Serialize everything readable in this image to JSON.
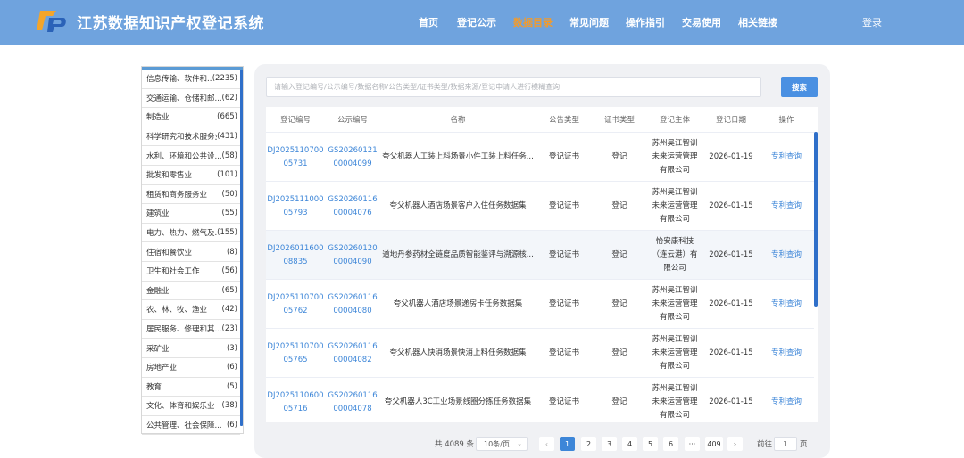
{
  "header": {
    "title": "江苏数据知识产权登记系统",
    "nav": [
      {
        "label": "首页",
        "active": false
      },
      {
        "label": "登记公示",
        "active": false
      },
      {
        "label": "数据目录",
        "active": true
      },
      {
        "label": "常见问题",
        "active": false
      },
      {
        "label": "操作指引",
        "active": false
      },
      {
        "label": "交易使用",
        "active": false
      },
      {
        "label": "相关链接",
        "active": false
      }
    ],
    "login": "登录",
    "accent_color": "#f39b2b",
    "bg_color": "#6fa3de"
  },
  "sidebar": {
    "categories": [
      {
        "name": "信息传输、软件和...",
        "count": "(2235)"
      },
      {
        "name": "交通运输、仓储和邮...",
        "count": "(62)"
      },
      {
        "name": "制造业",
        "count": "(665)"
      },
      {
        "name": "科学研究和技术服务业",
        "count": "(431)"
      },
      {
        "name": "水利、环境和公共设...",
        "count": "(58)"
      },
      {
        "name": "批发和零售业",
        "count": "(101)"
      },
      {
        "name": "租赁和商务服务业",
        "count": "(50)"
      },
      {
        "name": "建筑业",
        "count": "(55)"
      },
      {
        "name": "电力、热力、燃气及...",
        "count": "(155)"
      },
      {
        "name": "住宿和餐饮业",
        "count": "(8)"
      },
      {
        "name": "卫生和社会工作",
        "count": "(56)"
      },
      {
        "name": "金融业",
        "count": "(65)"
      },
      {
        "name": "农、林、牧、渔业",
        "count": "(42)"
      },
      {
        "name": "居民服务、修理和其...",
        "count": "(23)"
      },
      {
        "name": "采矿业",
        "count": "(3)"
      },
      {
        "name": "房地产业",
        "count": "(6)"
      },
      {
        "name": "教育",
        "count": "(5)"
      },
      {
        "name": "文化、体育和娱乐业",
        "count": "(38)"
      },
      {
        "name": "公共管理、社会保障...",
        "count": "(6)"
      }
    ]
  },
  "search": {
    "placeholder": "请输入登记编号/公示编号/数据名称/公告类型/证书类型/数据来源/登记申请人进行模糊查询",
    "button": "搜索"
  },
  "table": {
    "columns": [
      "登记编号",
      "公示编号",
      "名称",
      "公告类型",
      "证书类型",
      "登记主体",
      "登记日期",
      "操作"
    ],
    "rows": [
      {
        "reg_no": [
          "DJ2025110700",
          "05731"
        ],
        "pub_no": [
          "GS20260121",
          "00004099"
        ],
        "name": "夸父机器人工装上料场景小件工装上料任务...",
        "notice_type": "登记证书",
        "cert_type": "登记",
        "subject": [
          "苏州吴江智训",
          "未来运营管理",
          "有限公司"
        ],
        "date": "2026-01-19",
        "action": "专利查询"
      },
      {
        "reg_no": [
          "DJ2025111000",
          "05793"
        ],
        "pub_no": [
          "GS20260116",
          "00004076"
        ],
        "name": "夸父机器人酒店场景客户入住任务数据集",
        "notice_type": "登记证书",
        "cert_type": "登记",
        "subject": [
          "苏州吴江智训",
          "未来运营管理",
          "有限公司"
        ],
        "date": "2026-01-15",
        "action": "专利查询"
      },
      {
        "reg_no": [
          "DJ2026011600",
          "08835"
        ],
        "pub_no": [
          "GS20260120",
          "00004090"
        ],
        "name": "道地丹参药材全链度品质智能鉴评与溯源核...",
        "notice_type": "登记证书",
        "cert_type": "登记",
        "subject": [
          "怡安康科技",
          "（连云港）有",
          "限公司"
        ],
        "date": "2026-01-15",
        "action": "专利查询"
      },
      {
        "reg_no": [
          "DJ2025110700",
          "05762"
        ],
        "pub_no": [
          "GS20260116",
          "00004080"
        ],
        "name": "夸父机器人酒店场景递房卡任务数据集",
        "notice_type": "登记证书",
        "cert_type": "登记",
        "subject": [
          "苏州吴江智训",
          "未来运营管理",
          "有限公司"
        ],
        "date": "2026-01-15",
        "action": "专利查询"
      },
      {
        "reg_no": [
          "DJ2025110700",
          "05765"
        ],
        "pub_no": [
          "GS20260116",
          "00004082"
        ],
        "name": "夸父机器人快消场景快消上料任务数据集",
        "notice_type": "登记证书",
        "cert_type": "登记",
        "subject": [
          "苏州吴江智训",
          "未来运营管理",
          "有限公司"
        ],
        "date": "2026-01-15",
        "action": "专利查询"
      },
      {
        "reg_no": [
          "DJ2025110600",
          "05716"
        ],
        "pub_no": [
          "GS20260116",
          "00004078"
        ],
        "name": "夸父机器人3C工业场景线圈分拣任务数据集",
        "notice_type": "登记证书",
        "cert_type": "登记",
        "subject": [
          "苏州吴江智训",
          "未来运营管理",
          "有限公司"
        ],
        "date": "2026-01-15",
        "action": "专利查询"
      }
    ]
  },
  "pagination": {
    "total": "共 4089 条",
    "page_size": "10条/页",
    "prev": "‹",
    "pages": [
      "1",
      "2",
      "3",
      "4",
      "5",
      "6",
      "···",
      "409"
    ],
    "current": "1",
    "next": "›",
    "goto_prefix": "前往",
    "goto_value": "1",
    "goto_suffix": "页"
  }
}
